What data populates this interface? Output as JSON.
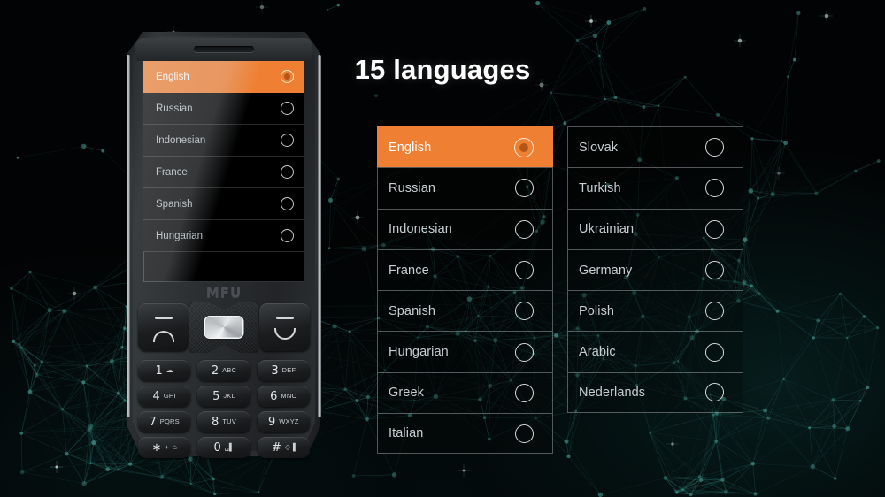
{
  "page": {
    "title": "15 languages",
    "background_color": "#020304",
    "accent_color": "#ef8033",
    "mesh_color": "#1c5f5a"
  },
  "languages": {
    "left_column": [
      {
        "label": "English",
        "selected": true
      },
      {
        "label": "Russian",
        "selected": false
      },
      {
        "label": "Indonesian",
        "selected": false
      },
      {
        "label": "France",
        "selected": false
      },
      {
        "label": "Spanish",
        "selected": false
      },
      {
        "label": "Hungarian",
        "selected": false
      },
      {
        "label": "Greek",
        "selected": false
      },
      {
        "label": "Italian",
        "selected": false
      }
    ],
    "right_column": [
      {
        "label": "Slovak",
        "selected": false
      },
      {
        "label": "Turkish",
        "selected": false
      },
      {
        "label": "Ukrainian",
        "selected": false
      },
      {
        "label": "Germany",
        "selected": false
      },
      {
        "label": "Polish",
        "selected": false
      },
      {
        "label": "Arabic",
        "selected": false
      },
      {
        "label": "Nederlands",
        "selected": false
      }
    ]
  },
  "phone": {
    "brand": "MFU",
    "screen_rows": [
      {
        "label": "English",
        "selected": true
      },
      {
        "label": "Russian",
        "selected": false
      },
      {
        "label": "Indonesian",
        "selected": false
      },
      {
        "label": "France",
        "selected": false
      },
      {
        "label": "Spanish",
        "selected": false
      },
      {
        "label": "Hungarian",
        "selected": false
      }
    ],
    "keypad": [
      {
        "digit": "1",
        "sub": "",
        "glyph": "☁"
      },
      {
        "digit": "2",
        "sub": "ABC",
        "glyph": ""
      },
      {
        "digit": "3",
        "sub": "DEF",
        "glyph": ""
      },
      {
        "digit": "4",
        "sub": "GHI",
        "glyph": ""
      },
      {
        "digit": "5",
        "sub": "JKL",
        "glyph": ""
      },
      {
        "digit": "6",
        "sub": "MNO",
        "glyph": ""
      },
      {
        "digit": "7",
        "sub": "PQRS",
        "glyph": ""
      },
      {
        "digit": "8",
        "sub": "TUV",
        "glyph": ""
      },
      {
        "digit": "9",
        "sub": "WXYZ",
        "glyph": ""
      },
      {
        "digit": "∗",
        "sub": "+",
        "glyph": "⌂"
      },
      {
        "digit": "0",
        "sub": "",
        "glyph": "␣▌"
      },
      {
        "digit": "#",
        "sub": "",
        "glyph": "◇▐"
      }
    ],
    "softkey_left": "menu-softkey",
    "softkey_right": "end-call-softkey"
  }
}
